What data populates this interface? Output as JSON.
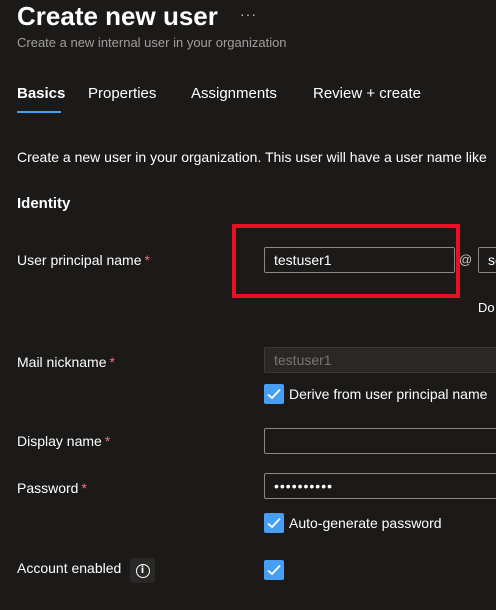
{
  "header": {
    "title": "Create new user",
    "more_label": "···",
    "subtitle": "Create a new internal user in your organization"
  },
  "tabs": [
    {
      "label": "Basics",
      "active": true
    },
    {
      "label": "Properties",
      "active": false
    },
    {
      "label": "Assignments",
      "active": false
    },
    {
      "label": "Review + create",
      "active": false
    }
  ],
  "intro": "Create a new user in your organization. This user will have a user name like",
  "identity": {
    "section_title": "Identity",
    "upn": {
      "label": "User principal name",
      "required": "*",
      "value": "testuser1",
      "at": "@",
      "domain_value": "so",
      "domain_label": "Do"
    },
    "mail_nickname": {
      "label": "Mail nickname",
      "required": "*",
      "value": "testuser1",
      "derive_label": "Derive from user principal name",
      "derive_checked": true
    },
    "display_name": {
      "label": "Display name",
      "required": "*",
      "value": ""
    },
    "password": {
      "label": "Password",
      "required": "*",
      "value": "••••••••••",
      "autogen_label": "Auto-generate password",
      "autogen_checked": true
    },
    "account_enabled": {
      "label": "Account enabled",
      "checked": true
    }
  },
  "colors": {
    "accent": "#479ef5",
    "highlight": "#e81123",
    "required": "#f1707b",
    "background": "#1b1a19"
  }
}
